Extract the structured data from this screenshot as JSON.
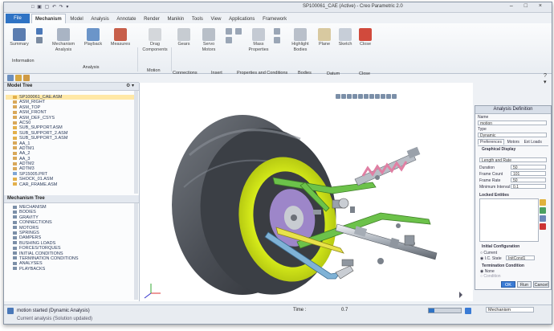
{
  "app": {
    "window_title": "SP100061_CAE (Active) - Creo Parametric 2.0",
    "file_tab": "File"
  },
  "ribbon": {
    "tabs": [
      "Mechanism",
      "Model",
      "Analysis",
      "Annotate",
      "Render",
      "Manikin",
      "Tools",
      "View",
      "Applications",
      "Framework"
    ],
    "active_tab": "Mechanism",
    "buttons": {
      "summary": "Summary",
      "mechanism_analysis": "Mechanism Analysis",
      "playback": "Playback",
      "measures": "Measures",
      "drag_components": "Drag Components",
      "gears": "Gears",
      "servo_motors": "Servo Motors",
      "mass_properties": "Mass Properties",
      "highlight_bodies": "Highlight Bodies",
      "plane": "Plane",
      "sketch": "Sketch",
      "close": "Close"
    },
    "groups": [
      "Information",
      "Analysis",
      "Motion",
      "Connections",
      "Insert",
      "Properties and Conditions",
      "Bodies",
      "Datum",
      "Close"
    ]
  },
  "model_tree": {
    "header": "Model Tree",
    "items": [
      {
        "label": "SP100061_CAE.ASM",
        "icon": "assembly-icon"
      },
      {
        "label": "ASM_RIGHT",
        "icon": "datum-plane-icon"
      },
      {
        "label": "ASM_TOP",
        "icon": "datum-plane-icon"
      },
      {
        "label": "ASM_FRONT",
        "icon": "datum-plane-icon"
      },
      {
        "label": "ASM_DEF_CSYS",
        "icon": "csys-icon"
      },
      {
        "label": "ACS0",
        "icon": "csys-icon"
      },
      {
        "label": "SUB_SUPPORT.ASM",
        "icon": "assembly-icon"
      },
      {
        "label": "SUB_SUPPORT_2.ASM",
        "icon": "assembly-icon"
      },
      {
        "label": "SUB_SUPPORT_3.ASM",
        "icon": "assembly-icon"
      },
      {
        "label": "AA_1",
        "icon": "axis-icon"
      },
      {
        "label": "ADTM1",
        "icon": "datum-plane-icon"
      },
      {
        "label": "AA_2",
        "icon": "axis-icon"
      },
      {
        "label": "AA_3",
        "icon": "axis-icon"
      },
      {
        "label": "ADTM2",
        "icon": "datum-plane-icon"
      },
      {
        "label": "ADTM3",
        "icon": "datum-plane-icon"
      },
      {
        "label": "SP15005.PRT",
        "icon": "part-icon"
      },
      {
        "label": "SHOCK_01.ASM",
        "icon": "assembly-icon"
      },
      {
        "label": "CAR_FRAME.ASM",
        "icon": "assembly-icon"
      }
    ]
  },
  "mechanism_tree": {
    "header": "Mechanism Tree",
    "items": [
      {
        "label": "MECHANISM",
        "icon": "mechanism-icon"
      },
      {
        "label": "BODIES",
        "icon": "bodies-icon"
      },
      {
        "label": "GRAVITY",
        "icon": "gravity-icon"
      },
      {
        "label": "CONNECTIONS",
        "icon": "connections-icon"
      },
      {
        "label": "MOTORS",
        "icon": "motor-icon"
      },
      {
        "label": "SPRINGS",
        "icon": "spring-icon"
      },
      {
        "label": "DAMPERS",
        "icon": "damper-icon"
      },
      {
        "label": "BUSHING LOADS",
        "icon": "bushing-icon"
      },
      {
        "label": "FORCES/TORQUES",
        "icon": "force-icon"
      },
      {
        "label": "INITIAL CONDITIONS",
        "icon": "initial-conditions-icon"
      },
      {
        "label": "TERMINATION CONDITIONS",
        "icon": "termination-icon"
      },
      {
        "label": "ANALYSES",
        "icon": "analyses-icon"
      },
      {
        "label": "PLAYBACKS",
        "icon": "playbacks-icon"
      }
    ]
  },
  "analysis_dialog": {
    "title": "Analysis Definition",
    "name_label": "Name",
    "name_value": "motion",
    "type_label": "Type",
    "type_value": "Dynamic",
    "tabs": [
      "Preferences",
      "Motors",
      "Ext Loads"
    ],
    "graphical_display": "Graphical Display",
    "length_rate": "Length and Rate",
    "fields": [
      {
        "label": "Duration",
        "value": "50"
      },
      {
        "label": "Frame Count",
        "value": "101"
      },
      {
        "label": "Frame Rate",
        "value": "50"
      },
      {
        "label": "Minimum Interval",
        "value": "0.1"
      }
    ],
    "locked_entities": "Locked Entities",
    "initial_configuration": "Initial Configuration",
    "current_label": "Current",
    "ic_state_label": "I.C. State",
    "ic_state_value": "InitCond1",
    "termination": "Termination Condition",
    "none_label": "None",
    "condition_label": "Condition",
    "ok": "OK",
    "run": "Run",
    "cancel": "Cancel"
  },
  "status": {
    "message": "motion started (Dynamic Analysis)",
    "message2": "Current analysis (Solution updated)",
    "time_label": "Time :",
    "time_value": "0.7",
    "filter_value": "Mechanism",
    "progress": 0.18
  },
  "colors": {
    "accent": "#2f73c4",
    "tire": "#4a4e55",
    "rim": "#d7ec1a",
    "green_arm": "#6cc24a",
    "yellow_arm": "#e8e24a"
  }
}
